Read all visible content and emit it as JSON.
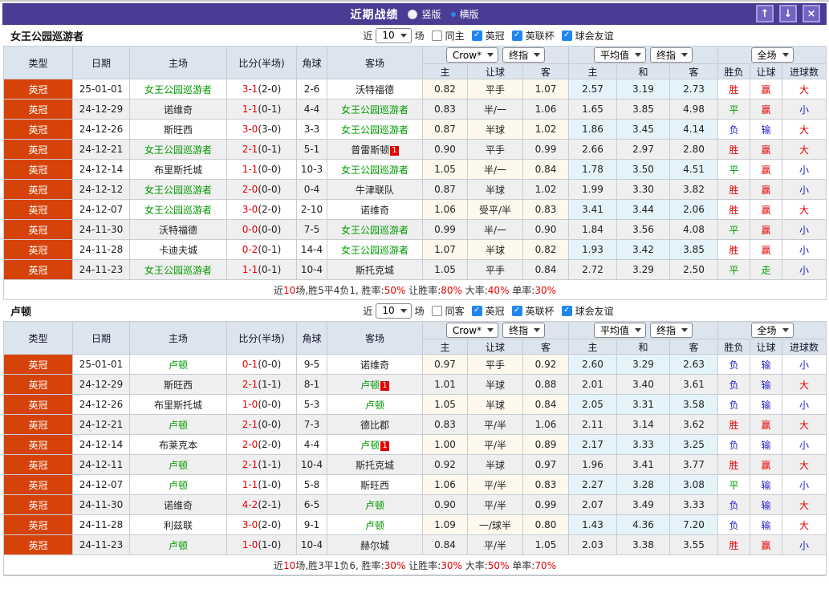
{
  "titlebar": {
    "title": "近期战绩",
    "radio_vertical": "竖版",
    "radio_horizontal": "横版",
    "up_button": "↑",
    "down_button": "↓",
    "close_button": "×"
  },
  "filter": {
    "near_label": "近",
    "count": "10",
    "games_label": "场",
    "leagues": [
      "英冠",
      "英联杯",
      "球会友谊"
    ]
  },
  "table_header": {
    "type": "类型",
    "date": "日期",
    "home": "主场",
    "score": "比分(半场)",
    "corner": "角球",
    "away": "客场",
    "company_select": "Crow*",
    "final_select": "终指",
    "avg_select": "平均值",
    "avg_final_select": "终指",
    "scope_select": "全场",
    "sub": [
      "主",
      "让球",
      "客",
      "主",
      "和",
      "客",
      "胜负",
      "让球",
      "进球数"
    ]
  },
  "colors": {
    "titlebar_bg": "#4a3c94",
    "league_badge_bg": "#d6430a",
    "team_highlight_green": "#009900",
    "score_red": "#e60000",
    "loss_blue": "#2222cc",
    "checkbox_blue": "#1f86f0",
    "header_bg": "#dce4ee",
    "row_alt_bg": "#efefef"
  },
  "result_colors": {
    "胜": "#e60000",
    "平": "#009900",
    "负": "#2222cc",
    "赢": "#e60000",
    "走": "#009900",
    "输": "#2222cc",
    "大": "#e60000",
    "小": "#2222cc"
  },
  "sections": [
    {
      "team": "女王公园巡游者",
      "same_label": "同主",
      "rows": [
        {
          "lg": "英冠",
          "dt": "25-01-01",
          "h": "女王公园巡游者",
          "hT": true,
          "sc": "3-1",
          "hf": "(2-0)",
          "cn": "2-6",
          "a": "沃特福德",
          "aT": false,
          "od": [
            "0.82",
            "平手",
            "1.07"
          ],
          "av": [
            "2.57",
            "3.19",
            "2.73"
          ],
          "rs": [
            "胜",
            "赢",
            "大"
          ]
        },
        {
          "lg": "英冠",
          "dt": "24-12-29",
          "h": "诺维奇",
          "hT": false,
          "sc": "1-1",
          "hf": "(0-1)",
          "cn": "4-4",
          "a": "女王公园巡游者",
          "aT": true,
          "od": [
            "0.83",
            "半/一",
            "1.06"
          ],
          "av": [
            "1.65",
            "3.85",
            "4.98"
          ],
          "rs": [
            "平",
            "赢",
            "小"
          ]
        },
        {
          "lg": "英冠",
          "dt": "24-12-26",
          "h": "斯旺西",
          "hT": false,
          "sc": "3-0",
          "hf": "(3-0)",
          "cn": "3-3",
          "a": "女王公园巡游者",
          "aT": true,
          "od": [
            "0.87",
            "半球",
            "1.02"
          ],
          "av": [
            "1.86",
            "3.45",
            "4.14"
          ],
          "rs": [
            "负",
            "输",
            "大"
          ]
        },
        {
          "lg": "英冠",
          "dt": "24-12-21",
          "h": "女王公园巡游者",
          "hT": true,
          "sc": "2-1",
          "hf": "(0-1)",
          "cn": "5-1",
          "a": "普雷斯顿",
          "aT": false,
          "aB": "1",
          "od": [
            "0.90",
            "平手",
            "0.99"
          ],
          "av": [
            "2.66",
            "2.97",
            "2.80"
          ],
          "rs": [
            "胜",
            "赢",
            "大"
          ]
        },
        {
          "lg": "英冠",
          "dt": "24-12-14",
          "h": "布里斯托城",
          "hT": false,
          "sc": "1-1",
          "hf": "(0-0)",
          "cn": "10-3",
          "a": "女王公园巡游者",
          "aT": true,
          "od": [
            "1.05",
            "半/一",
            "0.84"
          ],
          "av": [
            "1.78",
            "3.50",
            "4.51"
          ],
          "rs": [
            "平",
            "赢",
            "小"
          ]
        },
        {
          "lg": "英冠",
          "dt": "24-12-12",
          "h": "女王公园巡游者",
          "hT": true,
          "sc": "2-0",
          "hf": "(0-0)",
          "cn": "0-4",
          "a": "牛津联队",
          "aT": false,
          "od": [
            "0.87",
            "半球",
            "1.02"
          ],
          "av": [
            "1.99",
            "3.30",
            "3.82"
          ],
          "rs": [
            "胜",
            "赢",
            "小"
          ]
        },
        {
          "lg": "英冠",
          "dt": "24-12-07",
          "h": "女王公园巡游者",
          "hT": true,
          "sc": "3-0",
          "hf": "(2-0)",
          "cn": "2-10",
          "a": "诺维奇",
          "aT": false,
          "od": [
            "1.06",
            "受平/半",
            "0.83"
          ],
          "av": [
            "3.41",
            "3.44",
            "2.06"
          ],
          "rs": [
            "胜",
            "赢",
            "大"
          ]
        },
        {
          "lg": "英冠",
          "dt": "24-11-30",
          "h": "沃特福德",
          "hT": false,
          "sc": "0-0",
          "hf": "(0-0)",
          "cn": "7-5",
          "a": "女王公园巡游者",
          "aT": true,
          "od": [
            "0.99",
            "半/一",
            "0.90"
          ],
          "av": [
            "1.84",
            "3.56",
            "4.08"
          ],
          "rs": [
            "平",
            "赢",
            "小"
          ]
        },
        {
          "lg": "英冠",
          "dt": "24-11-28",
          "h": "卡迪夫城",
          "hT": false,
          "sc": "0-2",
          "hf": "(0-1)",
          "cn": "14-4",
          "a": "女王公园巡游者",
          "aT": true,
          "od": [
            "1.07",
            "半球",
            "0.82"
          ],
          "av": [
            "1.93",
            "3.42",
            "3.85"
          ],
          "rs": [
            "胜",
            "赢",
            "小"
          ]
        },
        {
          "lg": "英冠",
          "dt": "24-11-23",
          "h": "女王公园巡游者",
          "hT": true,
          "sc": "1-1",
          "hf": "(0-1)",
          "cn": "10-4",
          "a": "斯托克城",
          "aT": false,
          "od": [
            "1.05",
            "平手",
            "0.84"
          ],
          "av": [
            "2.72",
            "3.29",
            "2.50"
          ],
          "rs": [
            "平",
            "走",
            "小"
          ]
        }
      ],
      "summary": [
        {
          "t": "近"
        },
        {
          "t": "10",
          "hl": true
        },
        {
          "t": "场,胜5平4负1, 胜率:"
        },
        {
          "t": "50%",
          "hl": true
        },
        {
          "t": " 让胜率:"
        },
        {
          "t": "80%",
          "hl": true
        },
        {
          "t": " 大率:"
        },
        {
          "t": "40%",
          "hl": true
        },
        {
          "t": " 单率:"
        },
        {
          "t": "30%",
          "hl": true
        }
      ]
    },
    {
      "team": "卢顿",
      "same_label": "同客",
      "rows": [
        {
          "lg": "英冠",
          "dt": "25-01-01",
          "h": "卢顿",
          "hT": true,
          "sc": "0-1",
          "hf": "(0-0)",
          "cn": "9-5",
          "a": "诺维奇",
          "aT": false,
          "od": [
            "0.97",
            "平手",
            "0.92"
          ],
          "av": [
            "2.60",
            "3.29",
            "2.63"
          ],
          "rs": [
            "负",
            "输",
            "小"
          ]
        },
        {
          "lg": "英冠",
          "dt": "24-12-29",
          "h": "斯旺西",
          "hT": false,
          "sc": "2-1",
          "hf": "(1-1)",
          "cn": "8-1",
          "a": "卢顿",
          "aT": true,
          "aB": "1",
          "od": [
            "1.01",
            "半球",
            "0.88"
          ],
          "av": [
            "2.01",
            "3.40",
            "3.61"
          ],
          "rs": [
            "负",
            "输",
            "大"
          ]
        },
        {
          "lg": "英冠",
          "dt": "24-12-26",
          "h": "布里斯托城",
          "hT": false,
          "sc": "1-0",
          "hf": "(0-0)",
          "cn": "5-3",
          "a": "卢顿",
          "aT": true,
          "od": [
            "1.05",
            "半球",
            "0.84"
          ],
          "av": [
            "2.05",
            "3.31",
            "3.58"
          ],
          "rs": [
            "负",
            "输",
            "小"
          ]
        },
        {
          "lg": "英冠",
          "dt": "24-12-21",
          "h": "卢顿",
          "hT": true,
          "sc": "2-1",
          "hf": "(0-0)",
          "cn": "7-3",
          "a": "德比郡",
          "aT": false,
          "od": [
            "0.83",
            "平/半",
            "1.06"
          ],
          "av": [
            "2.11",
            "3.14",
            "3.62"
          ],
          "rs": [
            "胜",
            "赢",
            "大"
          ]
        },
        {
          "lg": "英冠",
          "dt": "24-12-14",
          "h": "布莱克本",
          "hT": false,
          "sc": "2-0",
          "hf": "(2-0)",
          "cn": "4-4",
          "a": "卢顿",
          "aT": true,
          "aB": "1",
          "od": [
            "1.00",
            "平/半",
            "0.89"
          ],
          "av": [
            "2.17",
            "3.33",
            "3.25"
          ],
          "rs": [
            "负",
            "输",
            "小"
          ]
        },
        {
          "lg": "英冠",
          "dt": "24-12-11",
          "h": "卢顿",
          "hT": true,
          "sc": "2-1",
          "hf": "(1-1)",
          "cn": "10-4",
          "a": "斯托克城",
          "aT": false,
          "od": [
            "0.92",
            "半球",
            "0.97"
          ],
          "av": [
            "1.96",
            "3.41",
            "3.77"
          ],
          "rs": [
            "胜",
            "赢",
            "大"
          ]
        },
        {
          "lg": "英冠",
          "dt": "24-12-07",
          "h": "卢顿",
          "hT": true,
          "sc": "1-1",
          "hf": "(1-0)",
          "cn": "5-8",
          "a": "斯旺西",
          "aT": false,
          "od": [
            "1.06",
            "平/半",
            "0.83"
          ],
          "av": [
            "2.27",
            "3.28",
            "3.08"
          ],
          "rs": [
            "平",
            "输",
            "小"
          ]
        },
        {
          "lg": "英冠",
          "dt": "24-11-30",
          "h": "诺维奇",
          "hT": false,
          "sc": "4-2",
          "hf": "(2-1)",
          "cn": "6-5",
          "a": "卢顿",
          "aT": true,
          "od": [
            "0.90",
            "平/半",
            "0.99"
          ],
          "av": [
            "2.07",
            "3.49",
            "3.33"
          ],
          "rs": [
            "负",
            "输",
            "大"
          ]
        },
        {
          "lg": "英冠",
          "dt": "24-11-28",
          "h": "利兹联",
          "hT": false,
          "sc": "3-0",
          "hf": "(2-0)",
          "cn": "9-1",
          "a": "卢顿",
          "aT": true,
          "od": [
            "1.09",
            "一/球半",
            "0.80"
          ],
          "av": [
            "1.43",
            "4.36",
            "7.20"
          ],
          "rs": [
            "负",
            "输",
            "大"
          ]
        },
        {
          "lg": "英冠",
          "dt": "24-11-23",
          "h": "卢顿",
          "hT": true,
          "sc": "1-0",
          "hf": "(1-0)",
          "cn": "10-4",
          "a": "赫尔城",
          "aT": false,
          "od": [
            "0.84",
            "平/半",
            "1.05"
          ],
          "av": [
            "2.03",
            "3.38",
            "3.55"
          ],
          "rs": [
            "胜",
            "赢",
            "小"
          ]
        }
      ],
      "summary": [
        {
          "t": "近"
        },
        {
          "t": "10",
          "hl": true
        },
        {
          "t": "场,胜3平1负6, 胜率:"
        },
        {
          "t": "30%",
          "hl": true
        },
        {
          "t": " 让胜率:"
        },
        {
          "t": "30%",
          "hl": true
        },
        {
          "t": " 大率:"
        },
        {
          "t": "50%",
          "hl": true
        },
        {
          "t": " 单率:"
        },
        {
          "t": "70%",
          "hl": true
        }
      ]
    }
  ]
}
